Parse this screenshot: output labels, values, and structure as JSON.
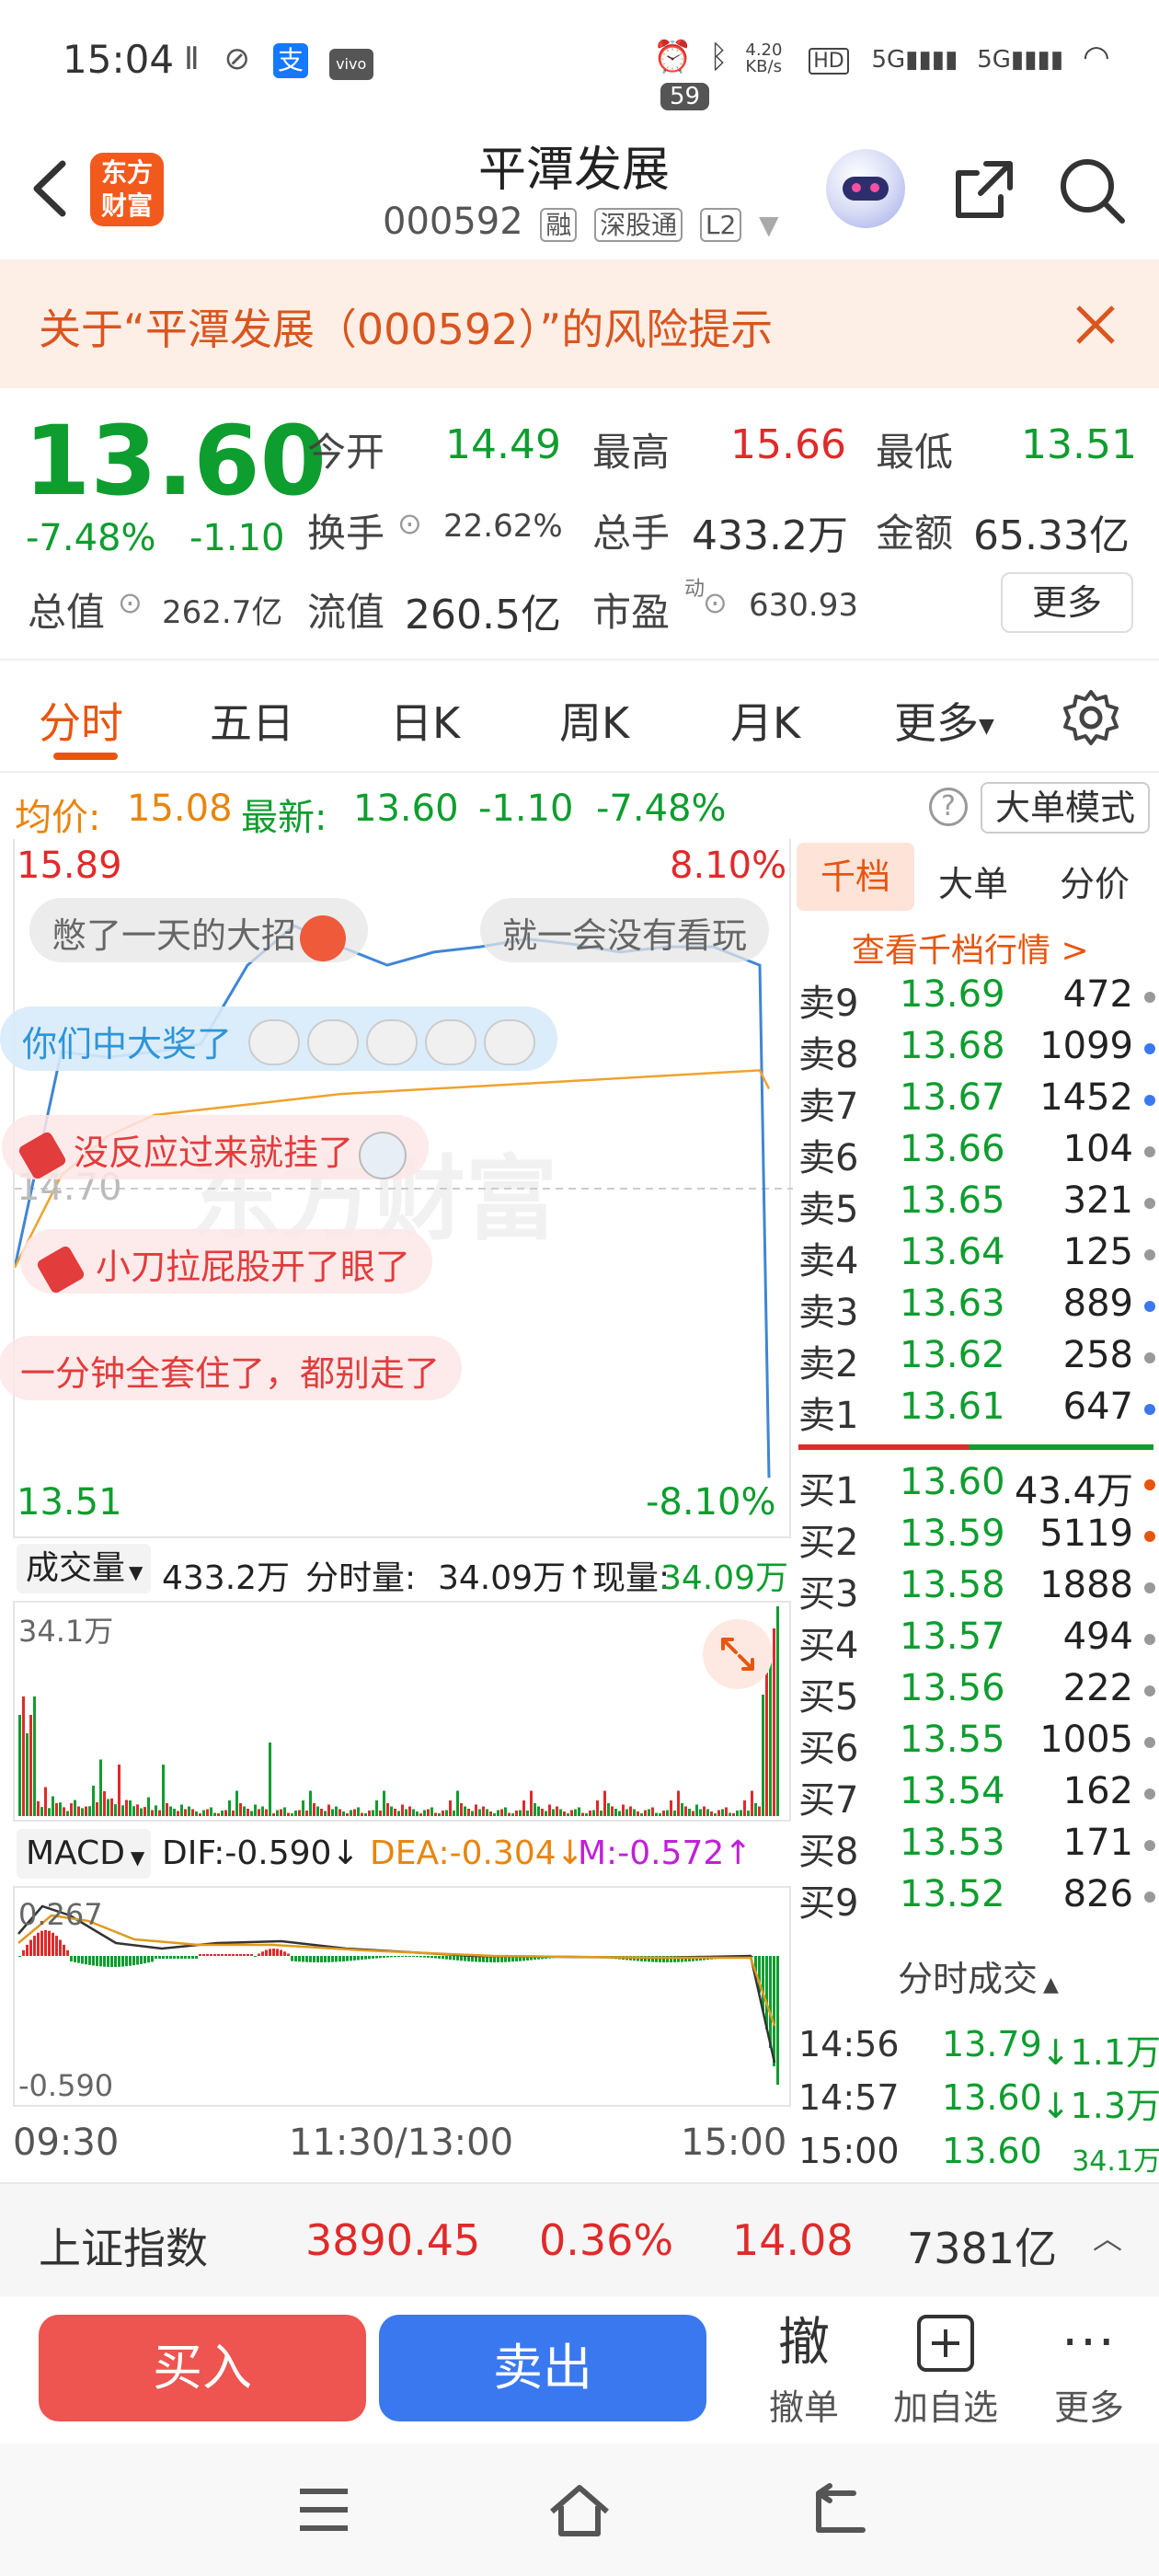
{
  "status": {
    "time": "15:04",
    "net_speed": "4.20\nKB/s",
    "battery": "59"
  },
  "header": {
    "logo_line1": "东方",
    "logo_line2": "财富",
    "title": "平潭发展",
    "code": "000592",
    "tags": [
      "融",
      "深股通",
      "L2"
    ]
  },
  "risk": {
    "text": "关于“平潭发展（000592）”的风险提示"
  },
  "quote": {
    "price": "13.60",
    "change_pct": "-7.48%",
    "change": "-1.10",
    "open_label": "今开",
    "open": "14.49",
    "high_label": "最高",
    "high": "15.66",
    "low_label": "最低",
    "low": "13.51",
    "turnover_label": "换手",
    "turnover": "22.62%",
    "volume_label": "总手",
    "volume": "433.2万",
    "amount_label": "金额",
    "amount": "65.33亿",
    "mktcap_label": "总值",
    "mktcap": "262.7亿",
    "float_label": "流值",
    "float": "260.5亿",
    "pe_label": "市盈",
    "pe_sup": "动",
    "pe": "630.93",
    "more": "更多"
  },
  "tabs": [
    "分时",
    "五日",
    "日K",
    "周K",
    "月K",
    "更多"
  ],
  "summary": {
    "avg_label": "均价:",
    "avg": "15.08",
    "latest_label": "最新:",
    "latest": "13.60",
    "chg": "-1.10",
    "pct": "-7.48%",
    "mode_button": "大单模式"
  },
  "chart": {
    "top_price": "15.89",
    "top_pct": "8.10%",
    "mid_price": "14.70",
    "bottom_price": "13.51",
    "bottom_pct": "-8.10%",
    "watermark": "东方财富",
    "danmu": [
      "憋了一天的大招",
      "就一会没有看玩",
      "你们中大奖了",
      "没反应过来就挂了",
      "小刀拉屁股开了眼了",
      "一分钟全套住了，都别走了"
    ]
  },
  "chart_data": {
    "type": "line",
    "title": "",
    "xlabel": "",
    "ylabel": "",
    "x": [
      "09:30",
      "11:30/13:00",
      "15:00"
    ],
    "ylim": [
      13.51,
      15.89
    ],
    "series": [
      {
        "name": "",
        "values": [
          14.4,
          15.22,
          15.2,
          15.22,
          15.25,
          15.55,
          15.7,
          15.62,
          15.55,
          15.6,
          15.62,
          15.65,
          15.63,
          15.6,
          15.62,
          15.62,
          15.55,
          13.6
        ]
      },
      {
        "name": "均价",
        "values": [
          14.4,
          14.75,
          14.9,
          14.98,
          15.0,
          15.02,
          15.04,
          15.06,
          15.07,
          15.08,
          15.09,
          15.1,
          15.11,
          15.12,
          15.13,
          15.14,
          15.15,
          15.08
        ]
      }
    ]
  },
  "volume": {
    "selector": "成交量",
    "total": "433.2万",
    "minute_label": "分时量:",
    "minute": "34.09万",
    "now_label": "现量:",
    "now": "34.09万",
    "max_label": "34.1万"
  },
  "macd": {
    "selector": "MACD",
    "dif_label": "DIF:",
    "dif": "-0.590",
    "dea_label": "DEA:",
    "dea": "-0.304",
    "m_label": "M:",
    "m": "-0.572",
    "top": "0.267",
    "bottom": "-0.590"
  },
  "time_axis": [
    "09:30",
    "11:30/13:00",
    "15:00"
  ],
  "book": {
    "tabs": [
      "千档",
      "大单",
      "分价"
    ],
    "link": "查看千档行情 >",
    "sells": [
      {
        "k": "卖9",
        "p": "13.69",
        "v": "472",
        "dot": "gray"
      },
      {
        "k": "卖8",
        "p": "13.68",
        "v": "1099",
        "dot": "blue"
      },
      {
        "k": "卖7",
        "p": "13.67",
        "v": "1452",
        "dot": "blue"
      },
      {
        "k": "卖6",
        "p": "13.66",
        "v": "104",
        "dot": "gray"
      },
      {
        "k": "卖5",
        "p": "13.65",
        "v": "321",
        "dot": "gray"
      },
      {
        "k": "卖4",
        "p": "13.64",
        "v": "125",
        "dot": "gray"
      },
      {
        "k": "卖3",
        "p": "13.63",
        "v": "889",
        "dot": "blue"
      },
      {
        "k": "卖2",
        "p": "13.62",
        "v": "258",
        "dot": "gray"
      },
      {
        "k": "卖1",
        "p": "13.61",
        "v": "647",
        "dot": "blue"
      }
    ],
    "buys": [
      {
        "k": "买1",
        "p": "13.60",
        "v": "43.4万",
        "dot": "orange"
      },
      {
        "k": "买2",
        "p": "13.59",
        "v": "5119",
        "dot": "orange"
      },
      {
        "k": "买3",
        "p": "13.58",
        "v": "1888",
        "dot": "gray"
      },
      {
        "k": "买4",
        "p": "13.57",
        "v": "494",
        "dot": "gray"
      },
      {
        "k": "买5",
        "p": "13.56",
        "v": "222",
        "dot": "gray"
      },
      {
        "k": "买6",
        "p": "13.55",
        "v": "1005",
        "dot": "gray"
      },
      {
        "k": "买7",
        "p": "13.54",
        "v": "162",
        "dot": "gray"
      },
      {
        "k": "买8",
        "p": "13.53",
        "v": "171",
        "dot": "gray"
      },
      {
        "k": "买9",
        "p": "13.52",
        "v": "826",
        "dot": "gray"
      }
    ],
    "ticks_title": "分时成交",
    "ticks": [
      {
        "t": "14:56",
        "p": "13.79",
        "v": "↓1.1万"
      },
      {
        "t": "14:57",
        "p": "13.60",
        "v": "↓1.3万"
      },
      {
        "t": "15:00",
        "p": "13.60",
        "v": "34.1万"
      }
    ]
  },
  "index": {
    "name": "上证指数",
    "value": "3890.45",
    "pct": "0.36%",
    "chg": "14.08",
    "amount": "7381亿"
  },
  "actions": {
    "buy": "买入",
    "sell": "卖出",
    "cancel_icon": "撤",
    "cancel": "撤单",
    "watch": "加自选",
    "more": "更多"
  }
}
